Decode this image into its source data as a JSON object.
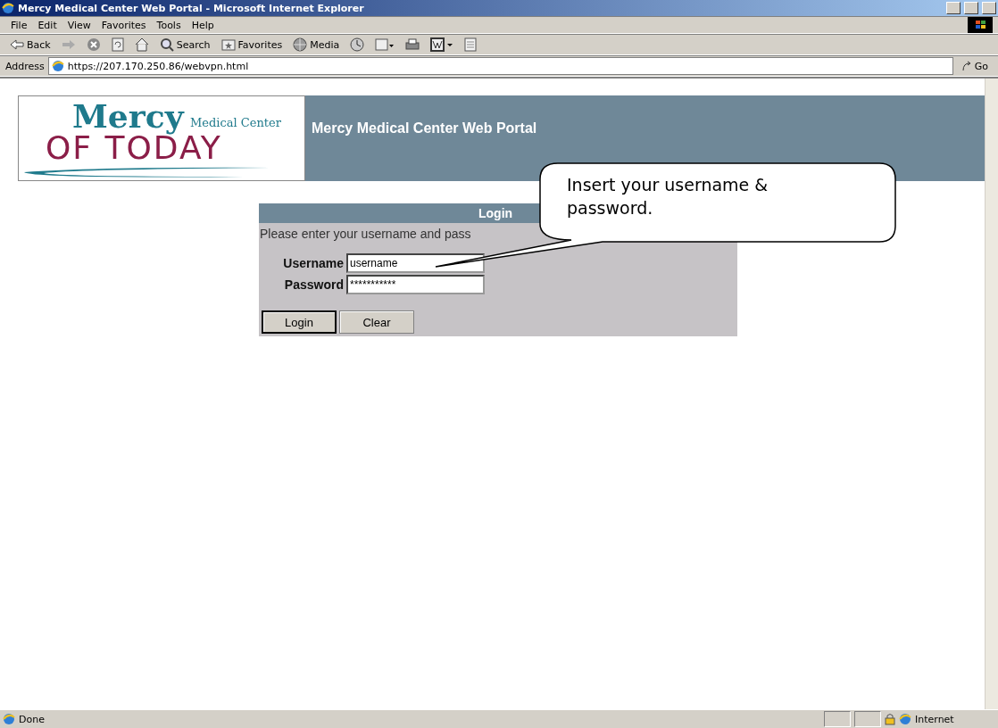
{
  "window": {
    "title": "Mercy Medical Center Web Portal - Microsoft Internet Explorer"
  },
  "menu": [
    "File",
    "Edit",
    "View",
    "Favorites",
    "Tools",
    "Help"
  ],
  "toolbar": [
    {
      "kind": "back",
      "label": "Back"
    },
    {
      "kind": "forward"
    },
    {
      "kind": "stop"
    },
    {
      "kind": "refresh"
    },
    {
      "kind": "home"
    },
    {
      "kind": "search",
      "label": "Search"
    },
    {
      "kind": "favorites",
      "label": "Favorites"
    },
    {
      "kind": "media",
      "label": "Media"
    },
    {
      "kind": "history"
    },
    {
      "kind": "mail"
    },
    {
      "kind": "print"
    },
    {
      "kind": "edit"
    },
    {
      "kind": "discuss"
    }
  ],
  "address": {
    "label": "Address",
    "url": "https://207.170.250.86/webvpn.html",
    "go": "Go"
  },
  "banner": {
    "logo_top": "Mercy",
    "logo_sub": "Medical Center",
    "logo_bottom": "OF TODAY",
    "title": "Mercy Medical Center Web Portal"
  },
  "login": {
    "title": "Login",
    "instructions": "Please enter your username and pass",
    "fields": [
      {
        "label": "Username",
        "value": "username"
      },
      {
        "label": "Password",
        "value": "***********"
      }
    ],
    "buttons": [
      {
        "label": "Login",
        "selected": true
      },
      {
        "label": "Clear",
        "selected": false
      }
    ]
  },
  "callout": {
    "text": "Insert your username & password."
  },
  "status_bar": {
    "text": "Done",
    "zone": "Internet"
  }
}
